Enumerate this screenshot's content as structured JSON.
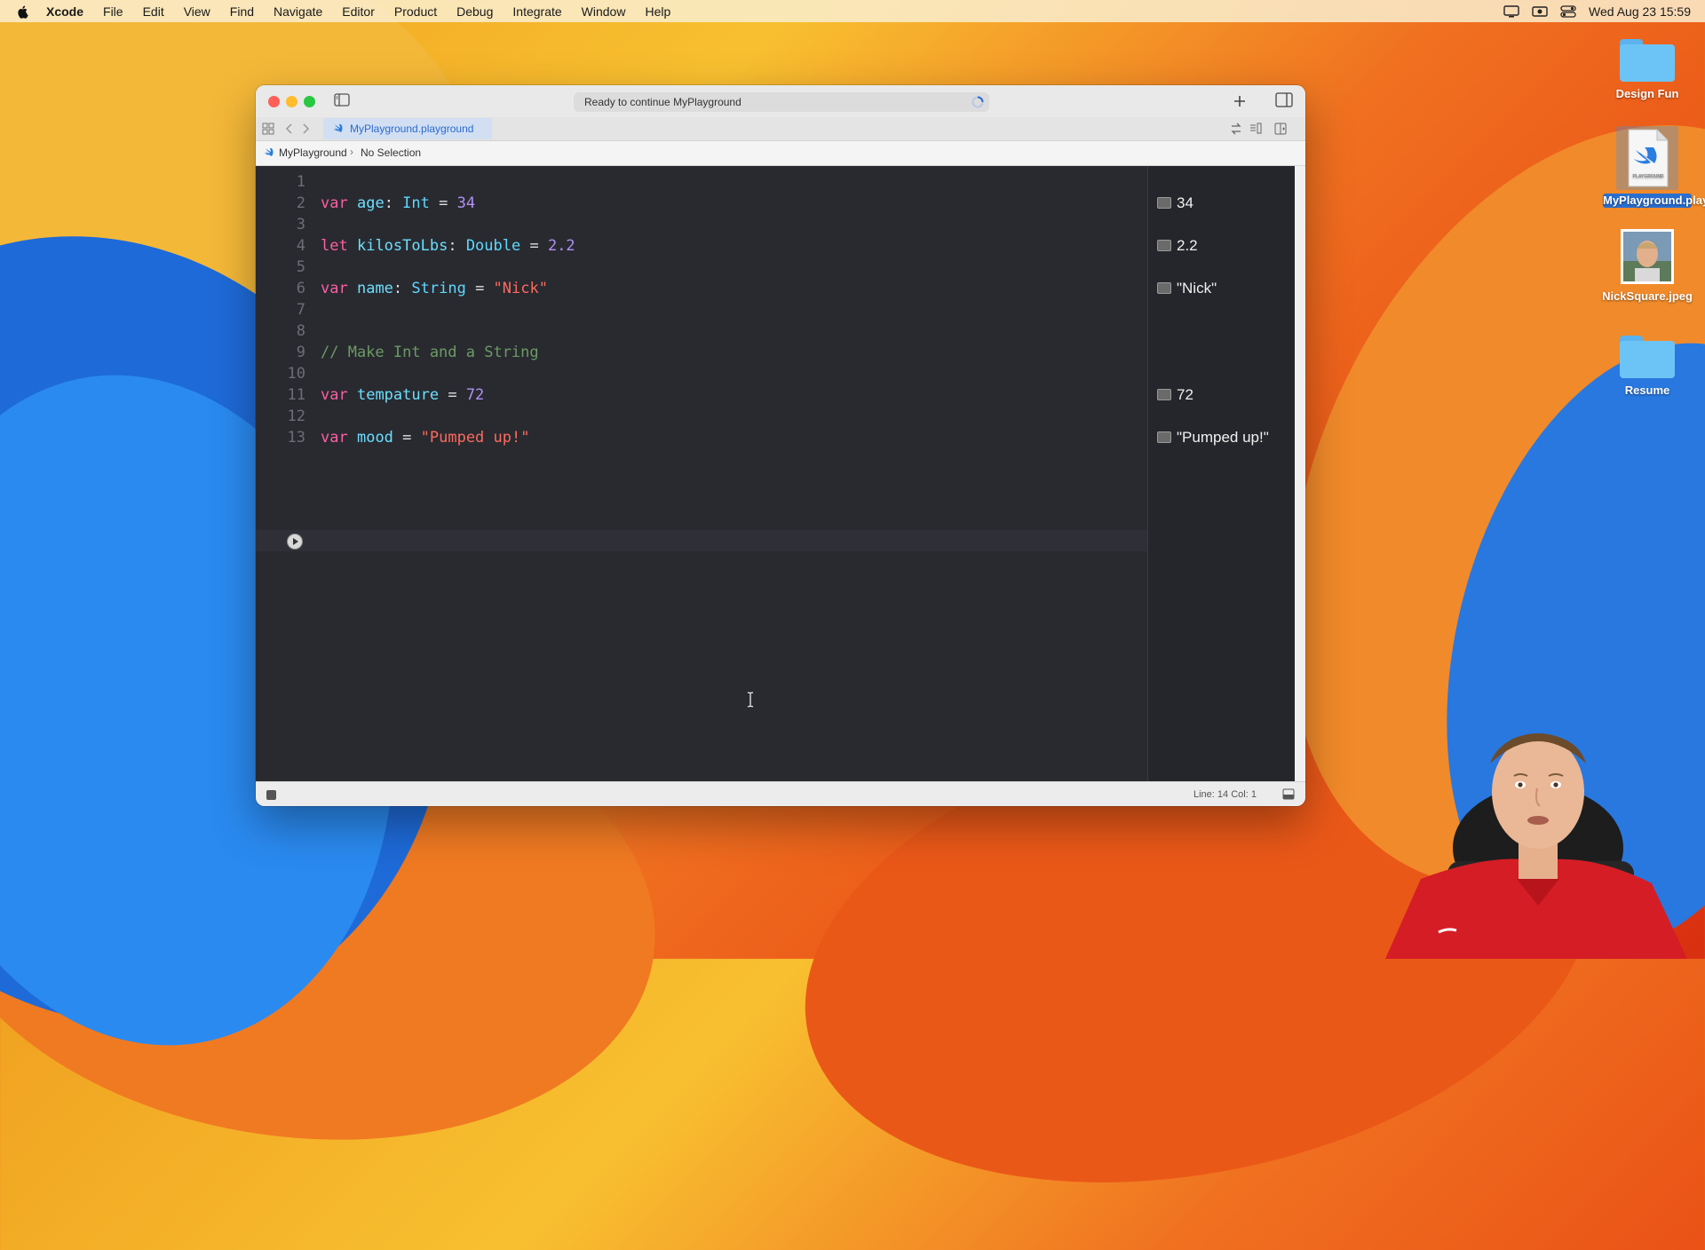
{
  "menubar": {
    "app_name": "Xcode",
    "items": [
      "File",
      "Edit",
      "View",
      "Find",
      "Navigate",
      "Editor",
      "Product",
      "Debug",
      "Integrate",
      "Window",
      "Help"
    ],
    "clock": "Wed Aug 23  15:59",
    "status_icons": [
      "display-icon",
      "screen-record-icon",
      "control-center-icon"
    ]
  },
  "desktop": {
    "icons": [
      {
        "label": "Design Fun",
        "icon": "folder-icon"
      },
      {
        "label": "MyPlayground.playground",
        "icon": "playground-file-icon"
      },
      {
        "label": "NickSquare.jpeg",
        "icon": "photo-thumbnail"
      },
      {
        "label": "Resume",
        "icon": "folder-icon"
      }
    ]
  },
  "window": {
    "activity_status": "Ready to continue MyPlayground",
    "file_tab": "MyPlayground.playground",
    "breadcrumb": {
      "project": "MyPlayground",
      "selection": "No Selection"
    },
    "cursor_position": {
      "line": 14,
      "col": 1,
      "label": "Line: 14  Col: 1"
    }
  },
  "code": {
    "lines": [
      {
        "n": "1",
        "tokens": []
      },
      {
        "n": "2",
        "tokens": [
          [
            "kw",
            "var"
          ],
          [
            "pl",
            " "
          ],
          [
            "id",
            "age"
          ],
          [
            "pl",
            ": "
          ],
          [
            "ty",
            "Int"
          ],
          [
            "pl",
            " = "
          ],
          [
            "nm2",
            "34"
          ]
        ]
      },
      {
        "n": "3",
        "tokens": []
      },
      {
        "n": "4",
        "tokens": [
          [
            "kw",
            "let"
          ],
          [
            "pl",
            " "
          ],
          [
            "id",
            "kilosToLbs"
          ],
          [
            "pl",
            ": "
          ],
          [
            "ty",
            "Double"
          ],
          [
            "pl",
            " = "
          ],
          [
            "nm2",
            "2.2"
          ]
        ]
      },
      {
        "n": "5",
        "tokens": []
      },
      {
        "n": "6",
        "tokens": [
          [
            "kw",
            "var"
          ],
          [
            "pl",
            " "
          ],
          [
            "id",
            "name"
          ],
          [
            "pl",
            ": "
          ],
          [
            "ty",
            "String"
          ],
          [
            "pl",
            " = "
          ],
          [
            "st",
            "\"Nick\""
          ]
        ]
      },
      {
        "n": "7",
        "tokens": []
      },
      {
        "n": "8",
        "tokens": []
      },
      {
        "n": "9",
        "tokens": [
          [
            "cm",
            "// Make Int and a String"
          ]
        ]
      },
      {
        "n": "10",
        "tokens": []
      },
      {
        "n": "11",
        "tokens": [
          [
            "kw",
            "var"
          ],
          [
            "pl",
            " "
          ],
          [
            "id",
            "tempature"
          ],
          [
            "pl",
            " = "
          ],
          [
            "nm2",
            "72"
          ]
        ]
      },
      {
        "n": "12",
        "tokens": []
      },
      {
        "n": "13",
        "tokens": [
          [
            "kw",
            "var"
          ],
          [
            "pl",
            " "
          ],
          [
            "id",
            "mood"
          ],
          [
            "pl",
            " = "
          ],
          [
            "st",
            "\"Pumped up!\""
          ]
        ]
      }
    ]
  },
  "results": [
    {
      "line": 2,
      "value": "34"
    },
    {
      "line": 4,
      "value": "2.2"
    },
    {
      "line": 6,
      "value": "\"Nick\""
    },
    {
      "line": 11,
      "value": "72"
    },
    {
      "line": 13,
      "value": "\"Pumped up!\""
    }
  ],
  "colors": {
    "editor_bg": "#292a30",
    "keyword": "#fc5fa3",
    "identifier": "#6bdfff",
    "type": "#5dd8ff",
    "number": "#b191f3",
    "string": "#fc6a5d",
    "comment": "#6c9a63"
  }
}
